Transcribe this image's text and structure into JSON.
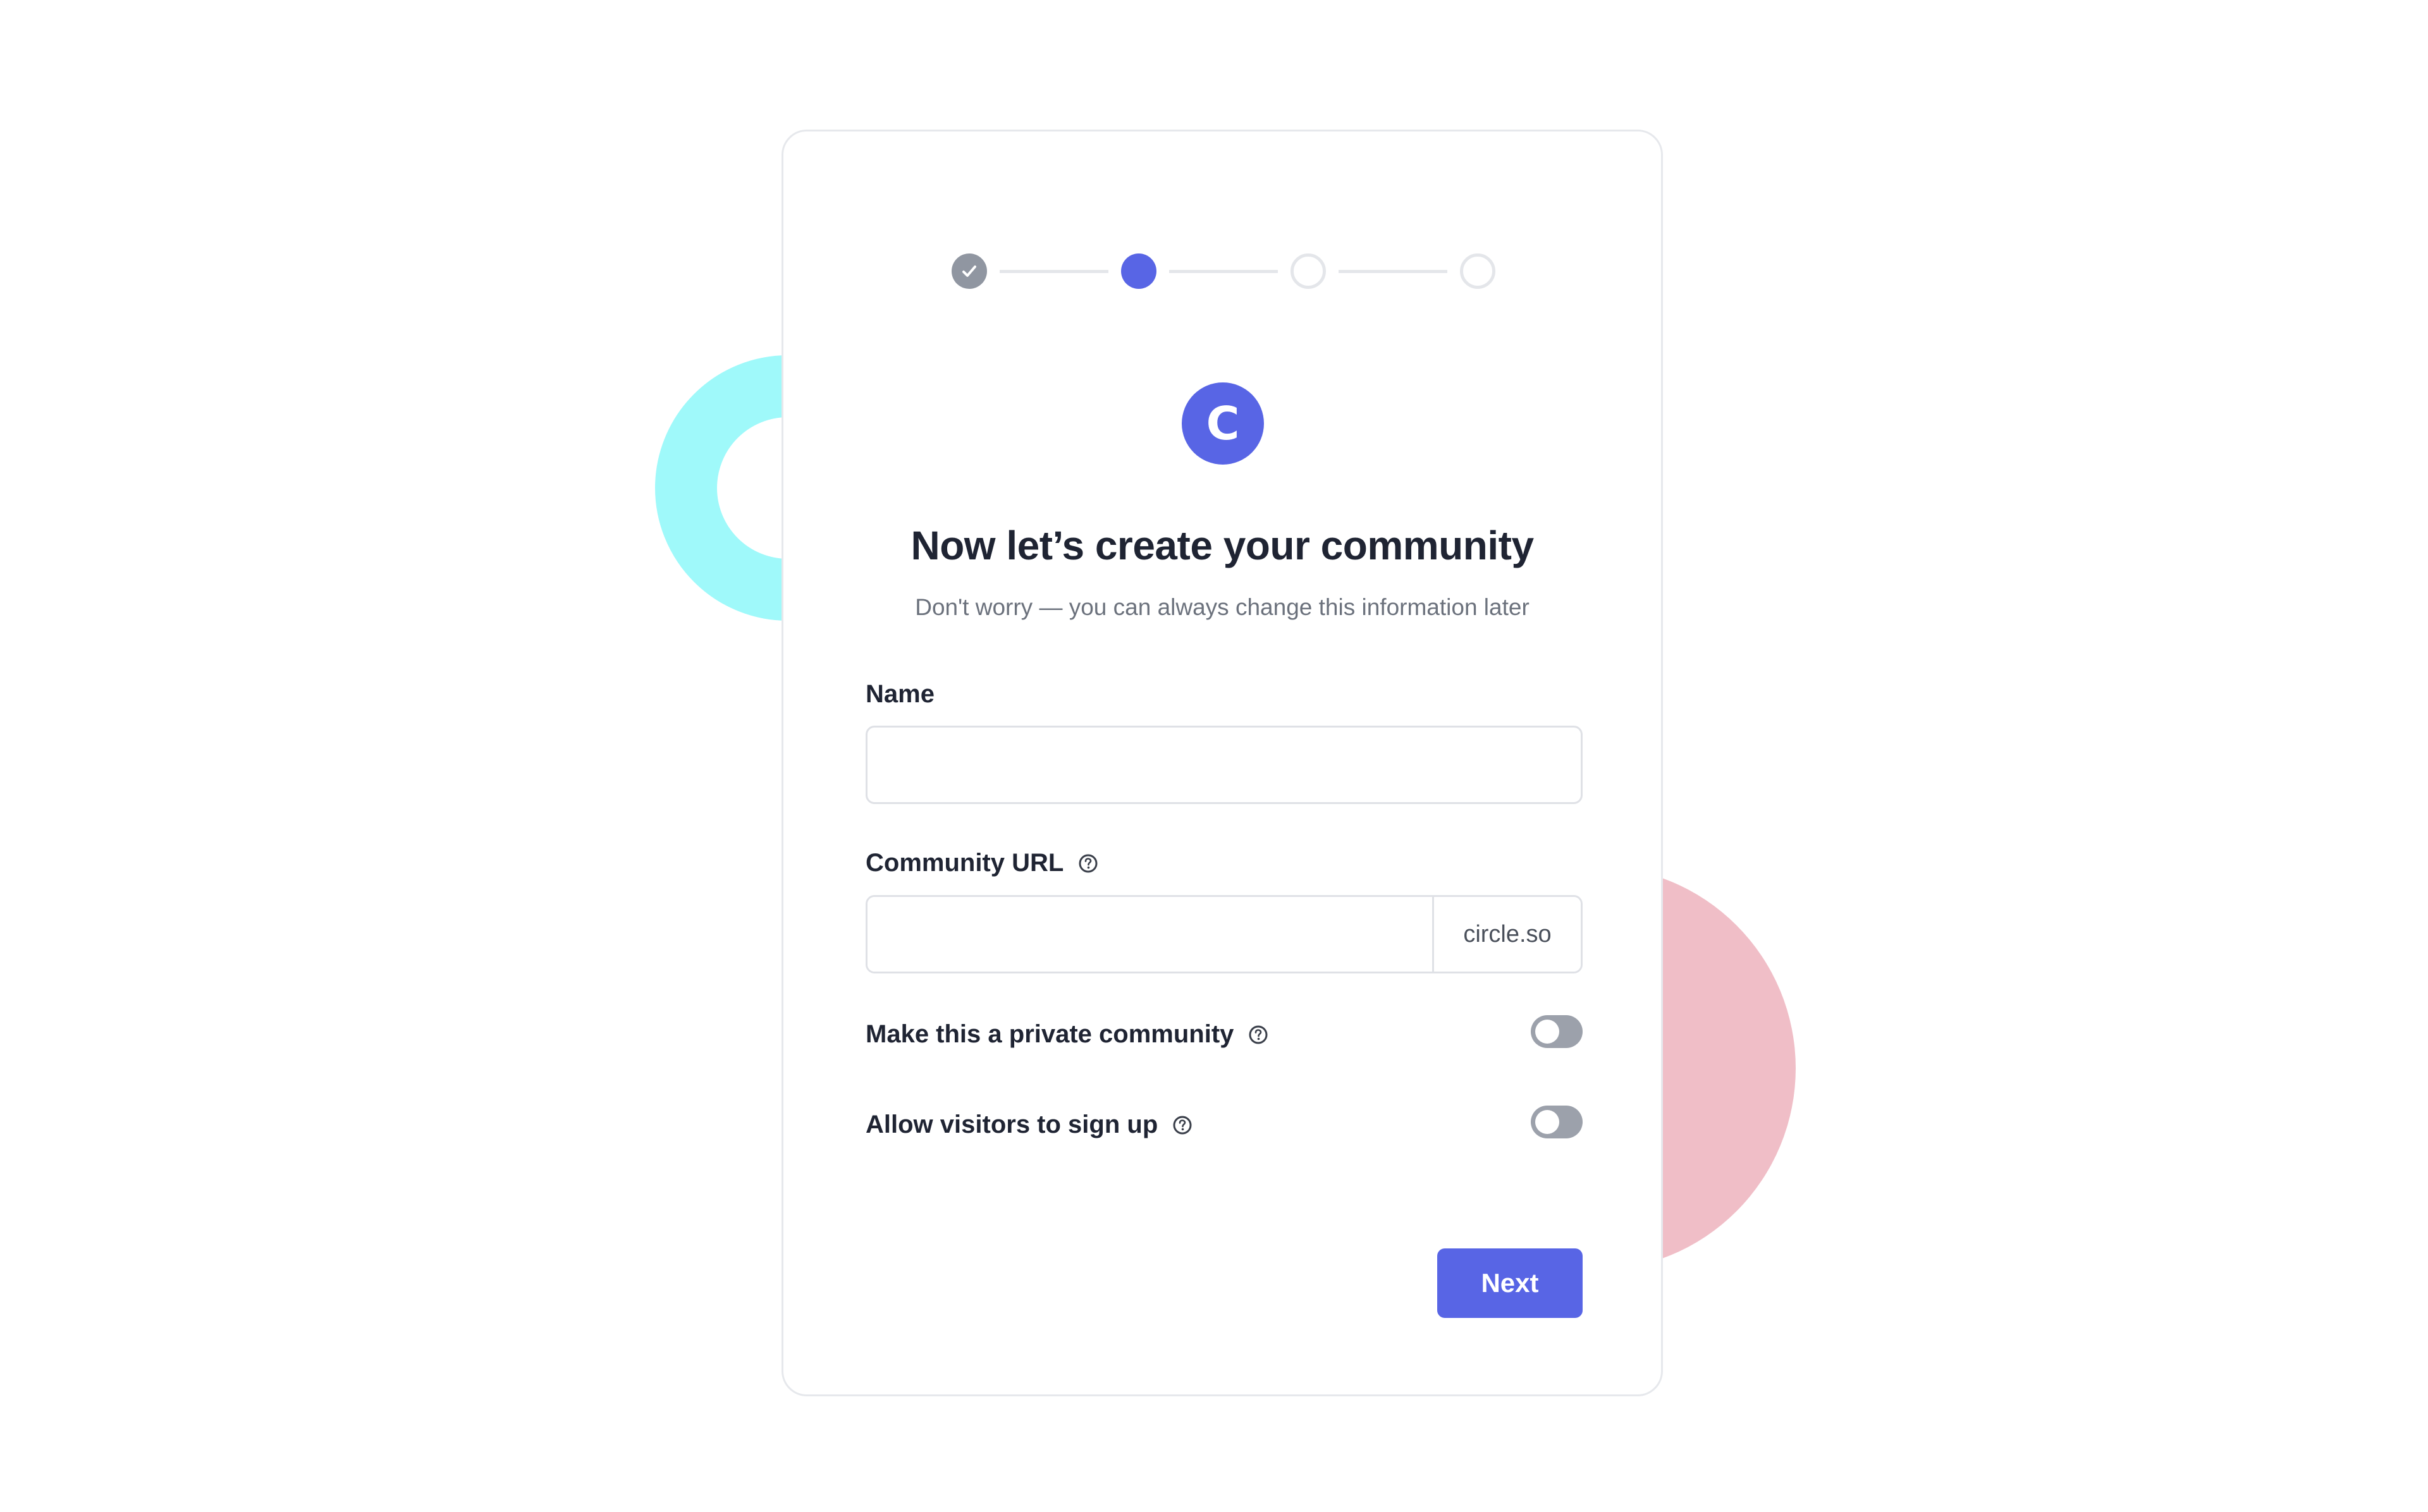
{
  "stepper": {
    "steps": [
      {
        "state": "completed",
        "icon": "check-icon"
      },
      {
        "state": "current"
      },
      {
        "state": "upcoming"
      },
      {
        "state": "upcoming"
      }
    ]
  },
  "logo": {
    "letter": "C"
  },
  "header": {
    "title": "Now let’s create your community",
    "subtitle": "Don't worry — you can always change this information later"
  },
  "form": {
    "name": {
      "label": "Name",
      "value": "",
      "placeholder": ""
    },
    "url": {
      "label": "Community URL",
      "value": "",
      "placeholder": "",
      "suffix": "circle.so",
      "help_icon": "question-circle-icon"
    },
    "private_toggle": {
      "label": "Make this a private community",
      "on": false,
      "help_icon": "question-circle-icon"
    },
    "signup_toggle": {
      "label": "Allow visitors to sign up",
      "on": false,
      "help_icon": "question-circle-icon"
    },
    "next_label": "Next"
  },
  "colors": {
    "accent": "#5865e5",
    "completed_step": "#9096a1",
    "deco_ring": "#9ff9fa",
    "deco_circle": "#f0bec7",
    "toggle_off": "#9ca1ab"
  }
}
